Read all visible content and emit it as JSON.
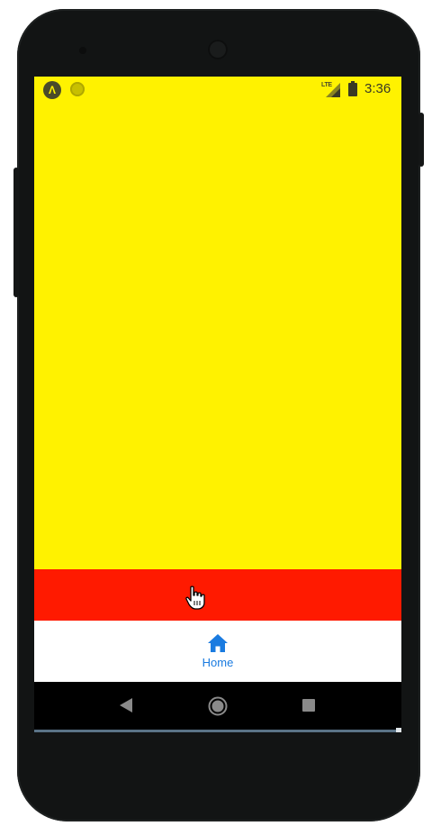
{
  "status_bar": {
    "app_icon_letter": "Λ",
    "network_label": "LTE",
    "time": "3:36"
  },
  "tab_bar": {
    "home_label": "Home"
  },
  "icons": {
    "home": "home-icon",
    "back": "back-triangle-icon",
    "nav_home": "circle-home-icon",
    "recents": "square-recents-icon",
    "cursor": "hand-pointer-icon"
  },
  "colors": {
    "screen_background": "#fff200",
    "red_bar": "#ff1a00",
    "tab_active": "#1a7be0",
    "nav_bar": "#000000"
  }
}
